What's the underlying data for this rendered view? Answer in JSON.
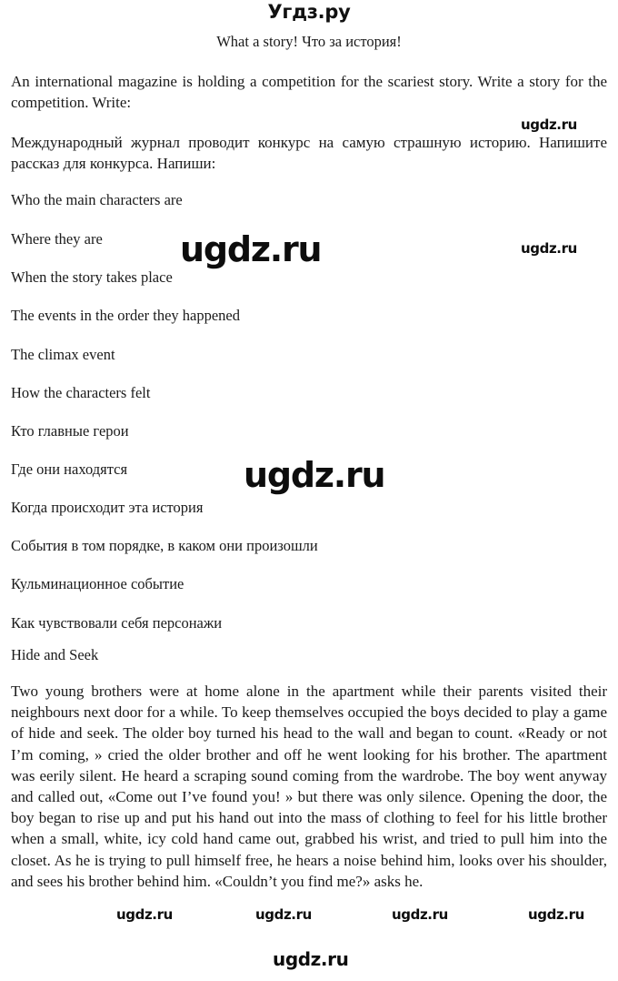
{
  "site": {
    "logo": "Угдз.ру",
    "watermark": "ugdz.ru"
  },
  "document": {
    "title": "What a story! Что за история!",
    "intro_en": "An international magazine is holding a competition for the scariest story. Write a story for the competition. Write:",
    "intro_ru": "Международный журнал проводит конкурс на самую страшную историю. Напишите рассказ для конкурса. Напиши:",
    "prompts_en": [
      "Who the main characters are",
      "Where they are",
      "When the story takes place",
      "The events in the order they happened",
      "The climax event",
      "How the characters felt"
    ],
    "prompts_ru": [
      "Кто главные герои",
      "Где они находятся",
      "Когда происходит эта история",
      "События в том порядке, в каком они произошли",
      "Кульминационное событие",
      "Как чувствовали себя персонажи"
    ],
    "story": {
      "title": "Hide and Seek",
      "text": "Two young brothers were at home alone in the apartment while their parents visited their neighbours next door for a while. To keep themselves occupied the boys decided to play a game of hide and seek. The older boy turned his head to the wall and began to count. «Ready or not I’m coming, » cried the older brother and off he went looking for his brother. The apartment was eerily silent. He heard a scraping sound coming from the wardrobe. The boy went anyway and called out, «Come out I’ve found you! » but there was only silence. Opening the door, the boy began to rise up and put his hand out into the mass of clothing to feel for his little brother when a small, white, icy cold hand came out, grabbed his wrist, and tried to pull him into the closet. As he is trying to pull himself free, he hears a noise behind him, looks over his shoulder, and sees his brother behind him. «Couldn’t you find me?» asks he."
    }
  }
}
